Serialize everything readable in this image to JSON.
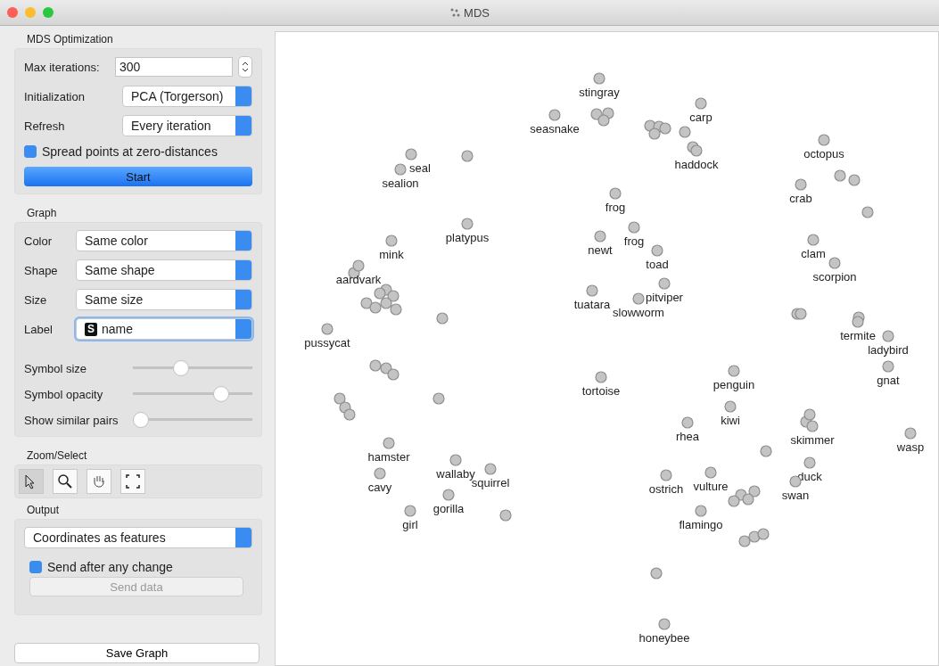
{
  "window": {
    "title": "MDS"
  },
  "mds_optimization": {
    "title": "MDS Optimization",
    "max_iterations": {
      "label": "Max iterations:",
      "value": "300"
    },
    "initialization": {
      "label": "Initialization",
      "value": "PCA (Torgerson)"
    },
    "refresh": {
      "label": "Refresh",
      "value": "Every iteration"
    },
    "spread": {
      "label": "Spread points at zero-distances",
      "checked": true
    },
    "start_button": "Start"
  },
  "graph": {
    "title": "Graph",
    "dropdowns": [
      {
        "label": "Color",
        "value": "Same color",
        "focused": false
      },
      {
        "label": "Shape",
        "value": "Same shape",
        "focused": false
      },
      {
        "label": "Size",
        "value": "Same size",
        "focused": false
      },
      {
        "label": "Label",
        "value": "name",
        "type_badge": "S",
        "focused": true
      }
    ],
    "sliders": [
      {
        "label": "Symbol size",
        "level": 0.39
      },
      {
        "label": "Symbol opacity",
        "level": 0.78
      },
      {
        "label": "Show similar pairs",
        "level": 0
      }
    ]
  },
  "zoom_select": {
    "title": "Zoom/Select",
    "tools": [
      {
        "kind": "pointer",
        "selected": true
      },
      {
        "kind": "zoom",
        "selected": false
      },
      {
        "kind": "pan",
        "selected": false
      },
      {
        "kind": "fit",
        "selected": false
      }
    ]
  },
  "output": {
    "title": "Output",
    "dropdown": "Coordinates as features",
    "auto_send": {
      "label": "Send after any change",
      "checked": true
    },
    "send_button": {
      "label": "Send data",
      "disabled": true
    }
  },
  "save_button": "Save Graph",
  "plot": {
    "points": [
      {
        "label": "stingray"
      },
      {
        "label": "seasnake"
      },
      {
        "label": "carp"
      },
      {
        "label": "octopus"
      },
      {
        "label": "seal"
      },
      {
        "label": "sealion"
      },
      {
        "label": "platypus"
      },
      {
        "label": "frog"
      },
      {
        "label": "frog"
      },
      {
        "label": "newt"
      },
      {
        "label": "toad"
      },
      {
        "label": "crab"
      },
      {
        "label": "clam"
      },
      {
        "label": "scorpion"
      },
      {
        "label": "mink"
      },
      {
        "label": "pitviper"
      },
      {
        "label": "tuatara"
      },
      {
        "label": "slowworm"
      },
      {
        "label": "aardvark"
      },
      {
        "label": "pussycat"
      },
      {
        "label": "haddock"
      },
      {
        "label": "termite"
      },
      {
        "label": "ladybird"
      },
      {
        "label": "gnat"
      },
      {
        "label": "penguin"
      },
      {
        "label": "tortoise"
      },
      {
        "label": "kiwi"
      },
      {
        "label": "rhea"
      },
      {
        "label": "skimmer"
      },
      {
        "label": "wasp"
      },
      {
        "label": "hamster"
      },
      {
        "label": "wallaby"
      },
      {
        "label": "squirrel"
      },
      {
        "label": "cavy"
      },
      {
        "label": "duck"
      },
      {
        "label": "swan"
      },
      {
        "label": "ostrich"
      },
      {
        "label": "vulture"
      },
      {
        "label": "gorilla"
      },
      {
        "label": "flamingo"
      },
      {
        "label": "girl"
      },
      {
        "label": "honeybee"
      }
    ]
  }
}
